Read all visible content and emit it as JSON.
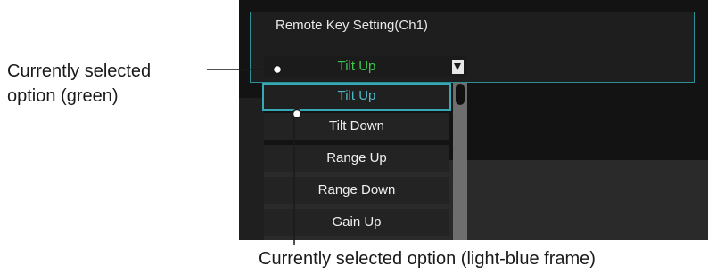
{
  "dialog": {
    "title": "Remote Key Setting(Ch1)",
    "current_value": "Tilt Up",
    "current_value_color": "#3ec84b",
    "frame_color": "#37a9b6"
  },
  "options": [
    "Tilt Up",
    "Tilt Down",
    "Range Up",
    "Range Down",
    "Gain Up"
  ],
  "selected_option": "Tilt Up",
  "annotations": {
    "green_line1": "Currently selected",
    "green_line2": "option (green)",
    "frame_label": "Currently selected option (light-blue frame)"
  },
  "icons": {
    "dropdown_arrow": "triangle-down-icon"
  }
}
